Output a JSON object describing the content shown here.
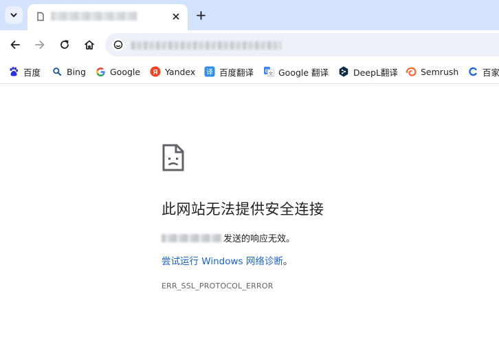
{
  "tab": {
    "favicon": "page-icon",
    "title": "",
    "close_label": "✕"
  },
  "toolbar": {
    "back_icon": "back-arrow-icon",
    "forward_icon": "forward-arrow-icon",
    "reload_icon": "reload-icon",
    "home_icon": "home-icon",
    "url": ""
  },
  "bookmarks": [
    {
      "label": "百度",
      "icon": "baidu-icon"
    },
    {
      "label": "Bing",
      "icon": "bing-search-icon"
    },
    {
      "label": "Google",
      "icon": "google-icon"
    },
    {
      "label": "Yandex",
      "icon": "yandex-icon"
    },
    {
      "label": "百度翻译",
      "icon": "baidu-translate-icon"
    },
    {
      "label": "Google 翻译",
      "icon": "google-translate-icon"
    },
    {
      "label": "DeepL翻译",
      "icon": "deepl-icon"
    },
    {
      "label": "Semrush",
      "icon": "semrush-icon"
    },
    {
      "label": "百家号",
      "icon": "baijiahao-icon"
    }
  ],
  "error": {
    "heading": "此网站无法提供安全连接",
    "description_suffix": "发送的响应无效。",
    "link": "尝试运行 Windows 网络诊断",
    "link_end": "。",
    "code": "ERR_SSL_PROTOCOL_ERROR"
  },
  "colors": {
    "tabstrip": "#d3e3fd",
    "link": "#1a62d0",
    "omnibox": "#eef2f8"
  }
}
